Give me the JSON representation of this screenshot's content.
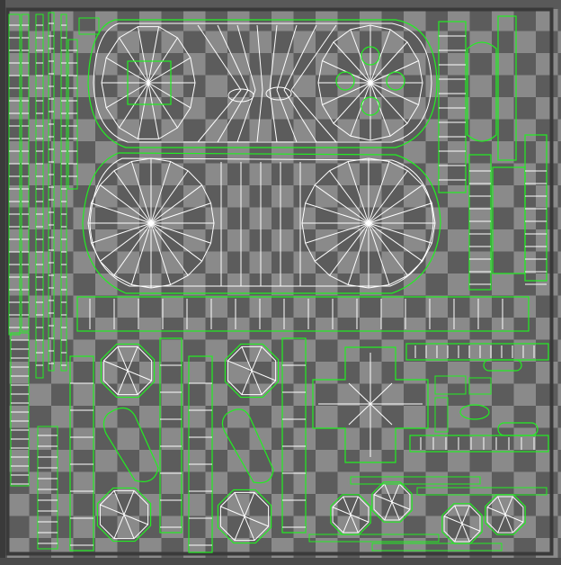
{
  "editor": {
    "view": "uv-layout",
    "background_color": "#595959",
    "checker_light": "#8a8a8a",
    "checker_dark": "#5c5c5c",
    "border_color": "#3a3a3a",
    "uv_edge_color": "#ffffff",
    "uv_boundary_color": "#22ee22"
  }
}
